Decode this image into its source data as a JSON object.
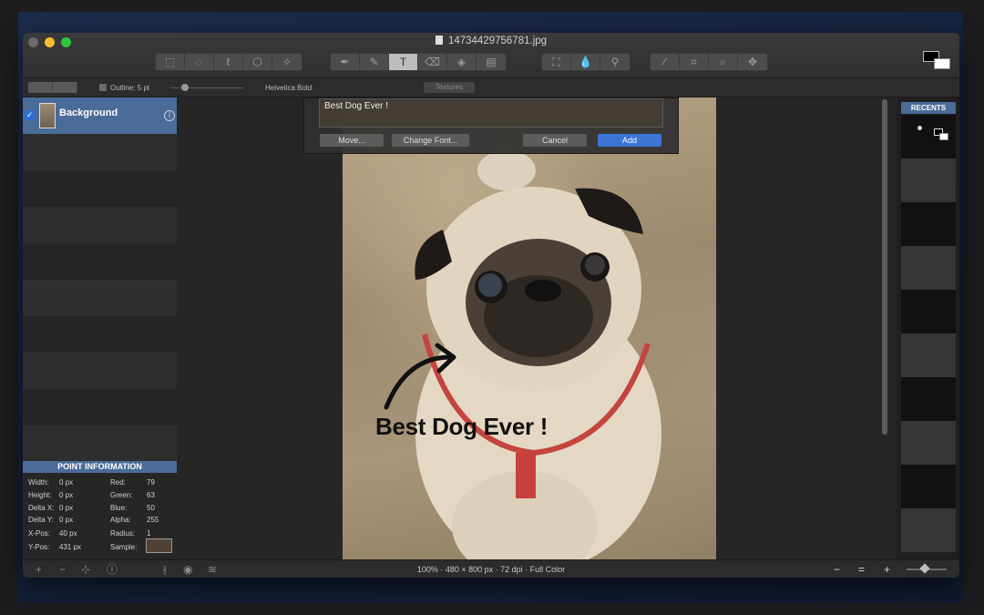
{
  "window": {
    "title": "14734429756781.jpg"
  },
  "toolbar": {
    "tools_group1": [
      "rect-select-icon",
      "ellipse-select-icon",
      "lasso-icon",
      "polygon-select-icon",
      "magic-wand-icon"
    ],
    "tools_group2": [
      "pen-icon",
      "pencil-icon",
      "text-icon",
      "eraser-icon",
      "paint-bucket-icon",
      "gradient-icon"
    ],
    "tools_group3": [
      "crop-select-icon",
      "blur-drop-icon",
      "clone-stamp-icon"
    ],
    "tools_group4": [
      "eyedropper-icon",
      "crop-icon",
      "zoom-icon",
      "move-icon"
    ],
    "active_tool": "text-icon"
  },
  "options": {
    "outline_label": "Outline: 5 pt",
    "font_label": "Helvetica Bold",
    "textures_label": "Textures"
  },
  "layers": {
    "items": [
      {
        "name": "Background",
        "selected": true
      }
    ]
  },
  "dialog": {
    "text_value": "Best Dog Ever !",
    "move_label": "Move...",
    "change_font_label": "Change Font...",
    "cancel_label": "Cancel",
    "add_label": "Add"
  },
  "canvas": {
    "overlay_text": "Best Dog Ever !"
  },
  "point_info": {
    "header": "POINT INFORMATION",
    "width_label": "Width:",
    "width_value": "0 px",
    "height_label": "Height:",
    "height_value": "0 px",
    "delta_x_label": "Delta X:",
    "delta_x_value": "0 px",
    "delta_y_label": "Delta Y:",
    "delta_y_value": "0 px",
    "x_pos_label": "X-Pos:",
    "x_pos_value": "40 px",
    "y_pos_label": "Y-Pos:",
    "y_pos_value": "431 px",
    "red_label": "Red:",
    "red_value": "79",
    "green_label": "Green:",
    "green_value": "63",
    "blue_label": "Blue:",
    "blue_value": "50",
    "alpha_label": "Alpha:",
    "alpha_value": "255",
    "radius_label": "Radius:",
    "radius_value": "1",
    "sample_label": "Sample:",
    "sample_color": "#4f4133"
  },
  "recents": {
    "header": "RECENTS"
  },
  "statusbar": {
    "info": "100% · 480 × 800 px · 72 dpi · Full Color",
    "zoom_out": "−",
    "zoom_fit": "=",
    "zoom_in": "+"
  },
  "colors": {
    "accent": "#4b6b98",
    "primary_button": "#3d74d6"
  }
}
